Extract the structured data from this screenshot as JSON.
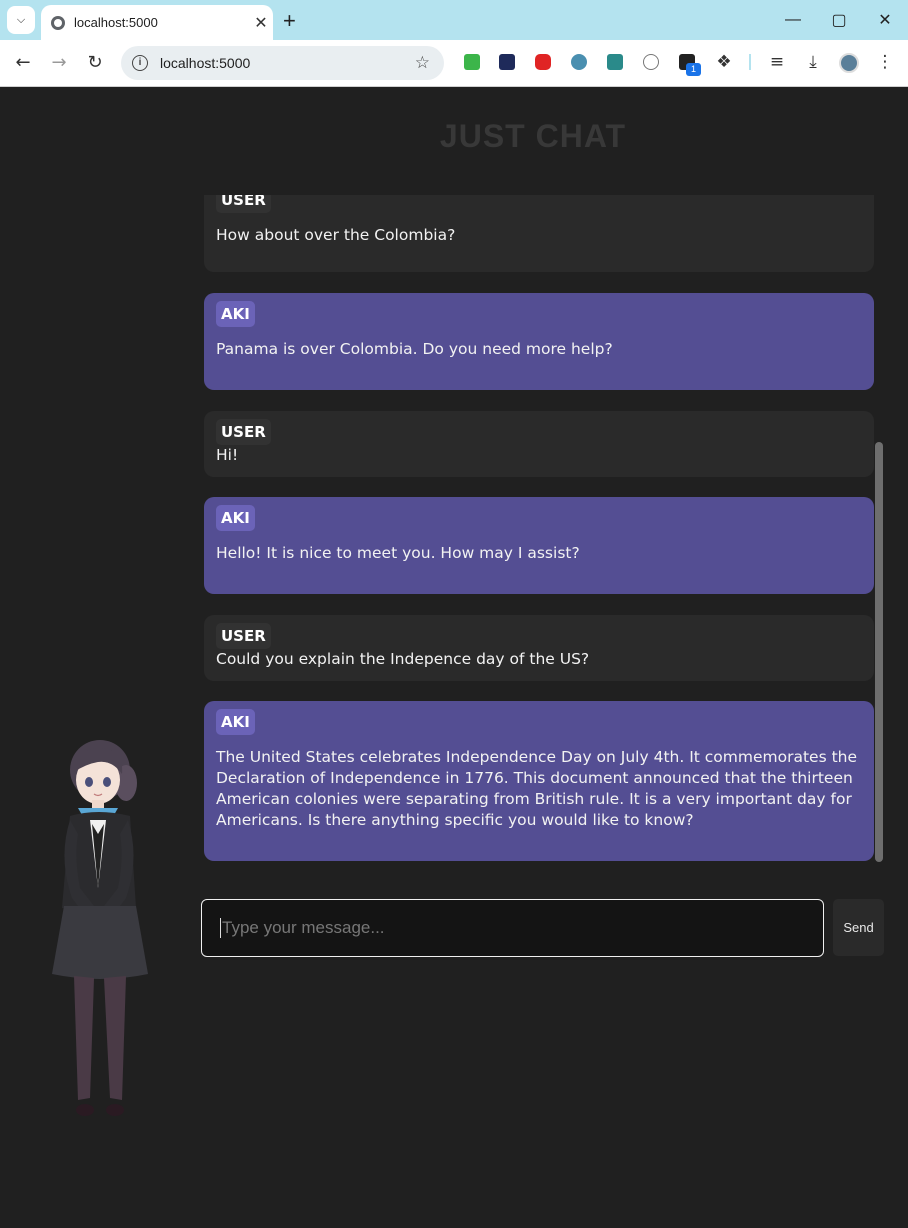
{
  "browser": {
    "tab_title": "localhost:5000",
    "url": "localhost:5000",
    "extension_badge": "1"
  },
  "page": {
    "title": "JUST CHAT"
  },
  "messages": [
    {
      "sender": "USER",
      "text": "How about over the Colombia?"
    },
    {
      "sender": "AKI",
      "text": "Panama is over Colombia. Do you need more help?"
    },
    {
      "sender": "USER",
      "text": "Hi!"
    },
    {
      "sender": "AKI",
      "text": "Hello! It is nice to meet you. How may I assist?"
    },
    {
      "sender": "USER",
      "text": "Could you explain the Indepence day of the US?"
    },
    {
      "sender": "AKI",
      "text_lines": [
        "The United States celebrates Independence Day on July 4th. It commemorates the",
        "Declaration of Independence in 1776. This document announced that the thirteen",
        "American colonies were separating from British rule. It is a very important day for",
        "Americans. Is there anything specific you would like to know?"
      ]
    }
  ],
  "composer": {
    "placeholder": "Type your message...",
    "send_label": "Send"
  }
}
